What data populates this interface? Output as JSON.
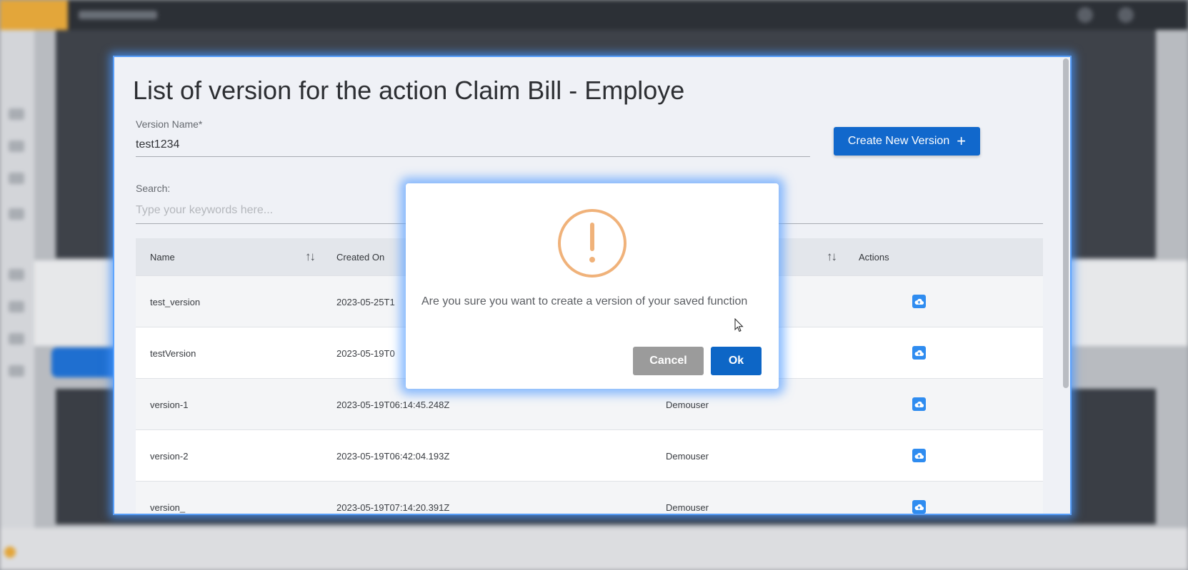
{
  "modal": {
    "title": "List of version for the action Claim Bill - Employe",
    "version_name": {
      "label": "Version Name*",
      "value": "test1234"
    },
    "create_button_label": "Create New Version",
    "create_button_icon": "plus-icon",
    "search": {
      "label": "Search:",
      "placeholder": "Type your keywords here..."
    },
    "table": {
      "columns": [
        "Name",
        "Created On",
        "",
        "Actions"
      ],
      "rows": [
        {
          "name": "test_version",
          "created_on": "2023-05-25T1",
          "created_by": ""
        },
        {
          "name": "testVersion",
          "created_on": "2023-05-19T0",
          "created_by": ""
        },
        {
          "name": "version-1",
          "created_on": "2023-05-19T06:14:45.248Z",
          "created_by": "Demouser"
        },
        {
          "name": "version-2",
          "created_on": "2023-05-19T06:42:04.193Z",
          "created_by": "Demouser"
        },
        {
          "name": "version_",
          "created_on": "2023-05-19T07:14:20.391Z",
          "created_by": "Demouser"
        }
      ],
      "action_icon": "upload-cloud-icon"
    }
  },
  "dialog": {
    "icon": "warning-icon",
    "icon_color": "#f0b27a",
    "message": "Are you sure you want to create a version of your saved function",
    "cancel_label": "Cancel",
    "ok_label": "Ok"
  },
  "colors": {
    "primary": "#1168cc",
    "cancel": "#9b9b9b",
    "warning": "#f0b27a"
  }
}
